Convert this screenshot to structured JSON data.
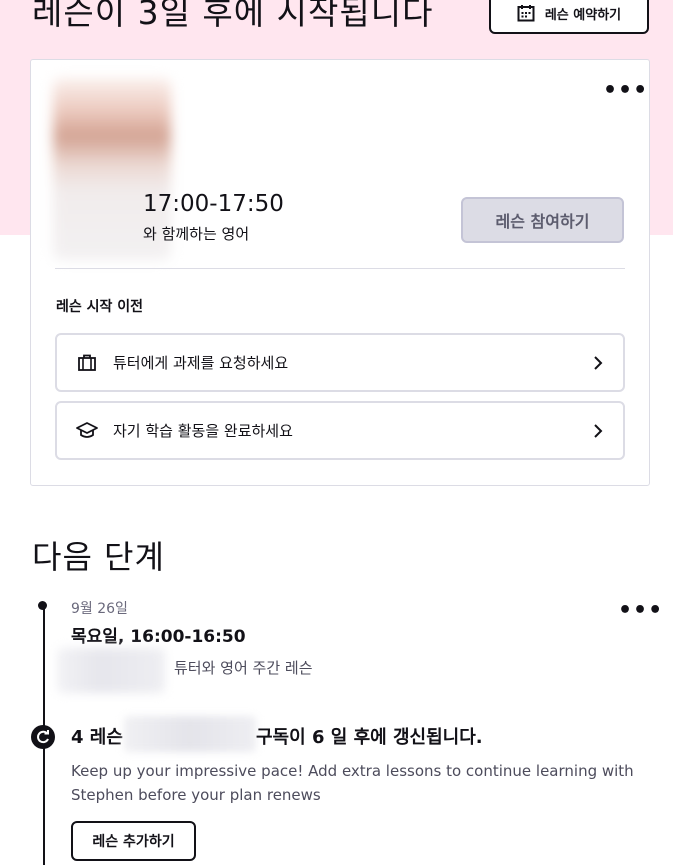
{
  "header": {
    "title": "레슨이 3일 후에 시작됩니다",
    "book_button": {
      "label": "레슨 예약하기",
      "icon": "calendar-icon"
    }
  },
  "lesson_card": {
    "menu_label": "•••",
    "time": "17:00-17:50",
    "description": "와 함께하는 영어",
    "join_button": "레슨 참여하기",
    "before_label": "레슨 시작 이전",
    "tasks": [
      {
        "label": "튜터에게 과제를 요청하세요",
        "icon": "briefcase-icon"
      },
      {
        "label": "자기 학습 활동을 완료하세요",
        "icon": "graduation-cap-icon"
      }
    ]
  },
  "next_steps": {
    "heading": "다음 단계",
    "event": {
      "date": "9월 26일",
      "when": "목요일, 16:00-16:50",
      "title": "튜터와 영어 주간 레슨",
      "menu_label": "•••"
    },
    "renewal": {
      "title_prefix": "4 레슨",
      "title_suffix": "구독이 6 일 후에 갱신됩니다.",
      "subtitle": "Keep up your impressive pace! Add extra lessons to continue learning with Stephen before your plan renews",
      "add_button": "레슨 추가하기",
      "icon": "renew-icon"
    }
  },
  "colors": {
    "accent_pink": "#ffe6ef",
    "text": "#121117",
    "border": "#dcdce5",
    "disabled_button": "#dcdce5"
  }
}
